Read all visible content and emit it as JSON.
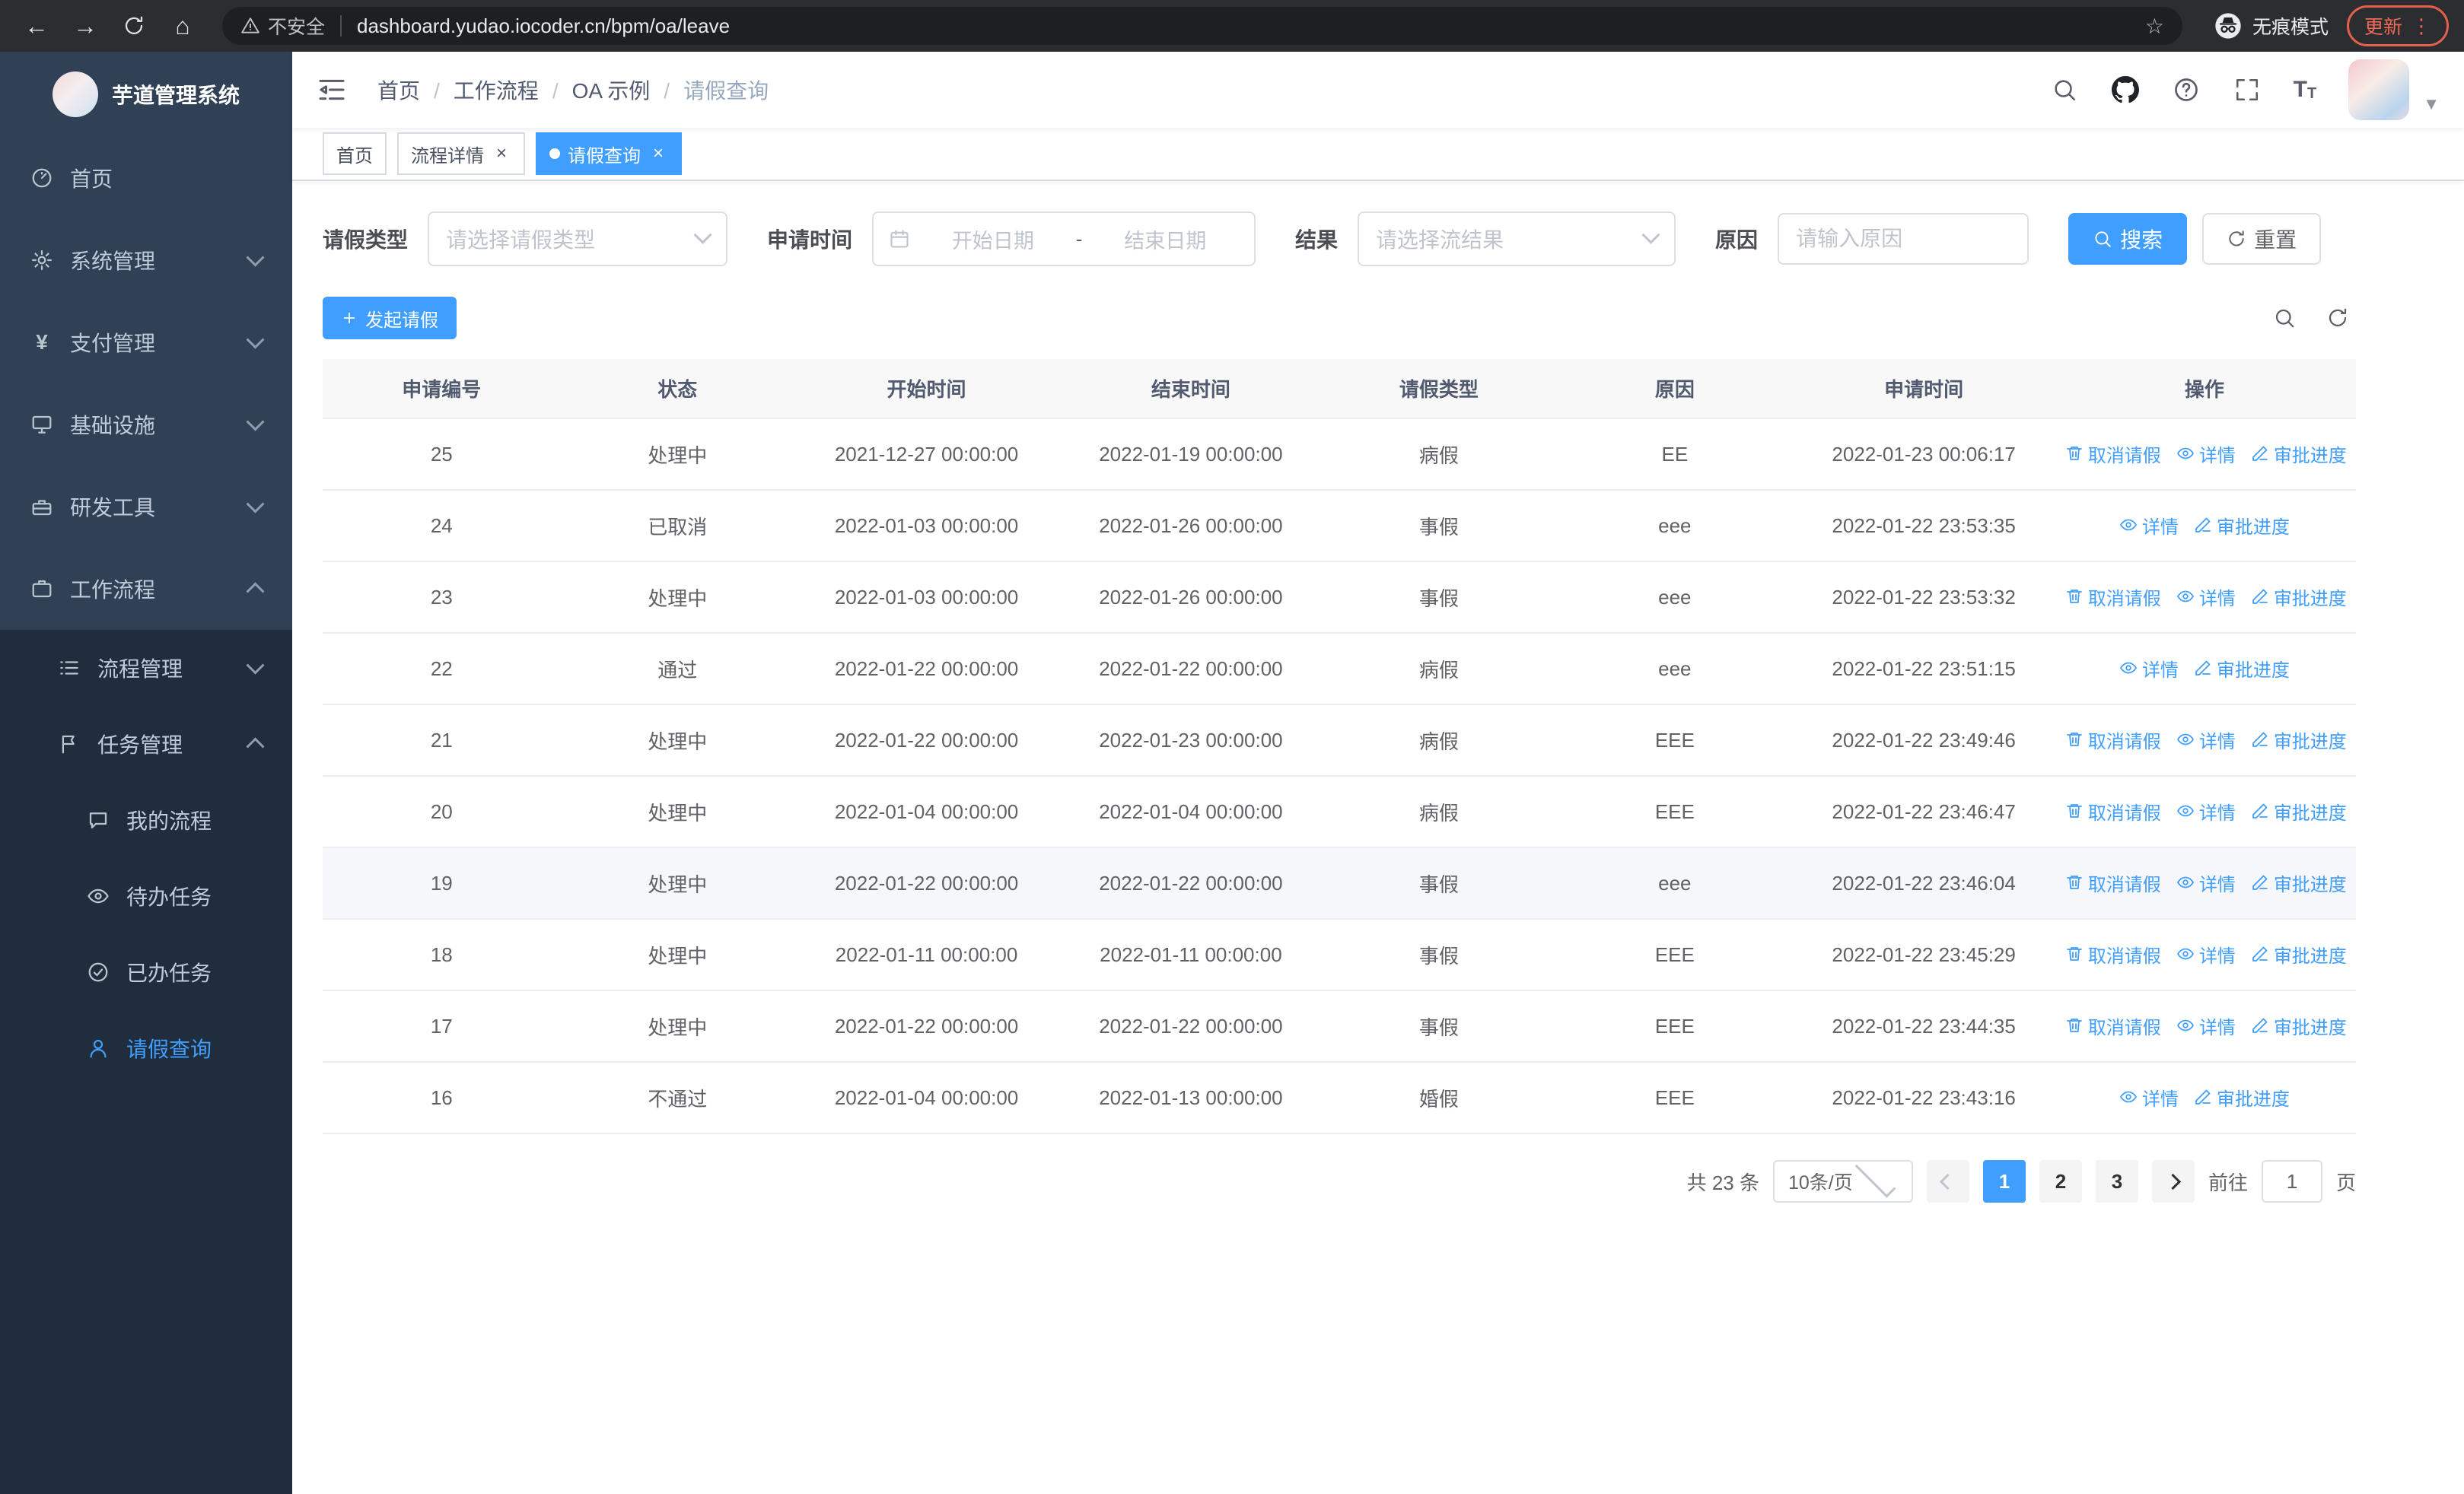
{
  "browser": {
    "security_label": "不安全",
    "url": "dashboard.yudao.iocoder.cn/bpm/oa/leave",
    "incognito_label": "无痕模式",
    "update_label": "更新"
  },
  "sidebar": {
    "app_title": "芋道管理系统",
    "items": [
      {
        "label": "首页"
      },
      {
        "label": "系统管理"
      },
      {
        "label": "支付管理"
      },
      {
        "label": "基础设施"
      },
      {
        "label": "研发工具"
      },
      {
        "label": "工作流程"
      }
    ],
    "submenu": [
      {
        "label": "流程管理"
      },
      {
        "label": "任务管理"
      }
    ],
    "children": [
      {
        "label": "我的流程"
      },
      {
        "label": "待办任务"
      },
      {
        "label": "已办任务"
      },
      {
        "label": "请假查询",
        "active": true
      }
    ]
  },
  "header": {
    "breadcrumb": [
      "首页",
      "工作流程",
      "OA 示例",
      "请假查询"
    ]
  },
  "tabs": [
    {
      "label": "首页",
      "closable": false,
      "active": false
    },
    {
      "label": "流程详情",
      "closable": true,
      "active": false
    },
    {
      "label": "请假查询",
      "closable": true,
      "active": true
    }
  ],
  "filters": {
    "leave_type_label": "请假类型",
    "leave_type_placeholder": "请选择请假类型",
    "apply_time_label": "申请时间",
    "date_start_placeholder": "开始日期",
    "date_separator": "-",
    "date_end_placeholder": "结束日期",
    "result_label": "结果",
    "result_placeholder": "请选择流结果",
    "reason_label": "原因",
    "reason_placeholder": "请输入原因",
    "search_label": "搜索",
    "reset_label": "重置"
  },
  "toolbar": {
    "create_label": "发起请假"
  },
  "table": {
    "columns": [
      "申请编号",
      "状态",
      "开始时间",
      "结束时间",
      "请假类型",
      "原因",
      "申请时间",
      "操作"
    ],
    "action_labels": {
      "cancel": "取消请假",
      "detail": "详情",
      "progress": "审批进度"
    },
    "rows": [
      {
        "id": "25",
        "status": "处理中",
        "start": "2021-12-27 00:00:00",
        "end": "2022-01-19 00:00:00",
        "type": "病假",
        "reason": "EE",
        "applied": "2022-01-23 00:06:17",
        "actions": [
          "cancel",
          "detail",
          "progress"
        ],
        "highlighted": false
      },
      {
        "id": "24",
        "status": "已取消",
        "start": "2022-01-03 00:00:00",
        "end": "2022-01-26 00:00:00",
        "type": "事假",
        "reason": "eee",
        "applied": "2022-01-22 23:53:35",
        "actions": [
          "detail",
          "progress"
        ],
        "highlighted": false
      },
      {
        "id": "23",
        "status": "处理中",
        "start": "2022-01-03 00:00:00",
        "end": "2022-01-26 00:00:00",
        "type": "事假",
        "reason": "eee",
        "applied": "2022-01-22 23:53:32",
        "actions": [
          "cancel",
          "detail",
          "progress"
        ],
        "highlighted": false
      },
      {
        "id": "22",
        "status": "通过",
        "start": "2022-01-22 00:00:00",
        "end": "2022-01-22 00:00:00",
        "type": "病假",
        "reason": "eee",
        "applied": "2022-01-22 23:51:15",
        "actions": [
          "detail",
          "progress"
        ],
        "highlighted": false
      },
      {
        "id": "21",
        "status": "处理中",
        "start": "2022-01-22 00:00:00",
        "end": "2022-01-23 00:00:00",
        "type": "病假",
        "reason": "EEE",
        "applied": "2022-01-22 23:49:46",
        "actions": [
          "cancel",
          "detail",
          "progress"
        ],
        "highlighted": false
      },
      {
        "id": "20",
        "status": "处理中",
        "start": "2022-01-04 00:00:00",
        "end": "2022-01-04 00:00:00",
        "type": "病假",
        "reason": "EEE",
        "applied": "2022-01-22 23:46:47",
        "actions": [
          "cancel",
          "detail",
          "progress"
        ],
        "highlighted": false
      },
      {
        "id": "19",
        "status": "处理中",
        "start": "2022-01-22 00:00:00",
        "end": "2022-01-22 00:00:00",
        "type": "事假",
        "reason": "eee",
        "applied": "2022-01-22 23:46:04",
        "actions": [
          "cancel",
          "detail",
          "progress"
        ],
        "highlighted": true
      },
      {
        "id": "18",
        "status": "处理中",
        "start": "2022-01-11 00:00:00",
        "end": "2022-01-11 00:00:00",
        "type": "事假",
        "reason": "EEE",
        "applied": "2022-01-22 23:45:29",
        "actions": [
          "cancel",
          "detail",
          "progress"
        ],
        "highlighted": false
      },
      {
        "id": "17",
        "status": "处理中",
        "start": "2022-01-22 00:00:00",
        "end": "2022-01-22 00:00:00",
        "type": "事假",
        "reason": "EEE",
        "applied": "2022-01-22 23:44:35",
        "actions": [
          "cancel",
          "detail",
          "progress"
        ],
        "highlighted": false
      },
      {
        "id": "16",
        "status": "不通过",
        "start": "2022-01-04 00:00:00",
        "end": "2022-01-13 00:00:00",
        "type": "婚假",
        "reason": "EEE",
        "applied": "2022-01-22 23:43:16",
        "actions": [
          "detail",
          "progress"
        ],
        "highlighted": false
      }
    ]
  },
  "pagination": {
    "total_label": "共 23 条",
    "page_size_label": "10条/页",
    "pages": [
      "1",
      "2",
      "3"
    ],
    "active_page": "1",
    "goto_label": "前往",
    "goto_value": "1",
    "page_unit_label": "页"
  },
  "colors": {
    "primary": "#409eff",
    "sidebar_bg": "#304156",
    "sidebar_sub_bg": "#1f2d3d",
    "update_badge": "#ee6a55"
  }
}
